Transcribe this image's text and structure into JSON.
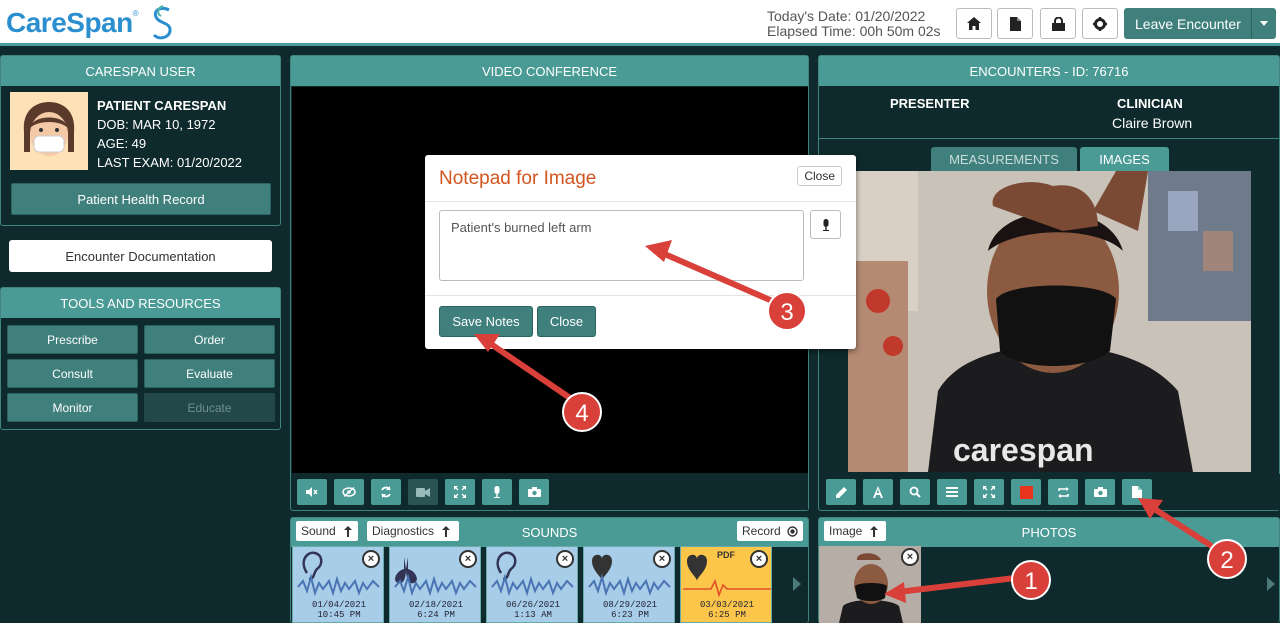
{
  "header": {
    "logo_text": "CareSpan",
    "today_date": "Today's Date: 01/20/2022",
    "elapsed_time": "Elapsed Time: 00h 50m 02s",
    "leave_label": "Leave Encounter"
  },
  "patient_panel": {
    "title": "CARESPAN USER",
    "name": "PATIENT CARESPAN",
    "dob": "DOB: MAR 10, 1972",
    "age": "AGE: 49",
    "last_exam": "LAST EXAM: 01/20/2022",
    "health_record_label": "Patient Health Record"
  },
  "encounter_doc_label": "Encounter Documentation",
  "tools": {
    "title": "TOOLS AND RESOURCES",
    "items": [
      {
        "label": "Prescribe"
      },
      {
        "label": "Order"
      },
      {
        "label": "Consult"
      },
      {
        "label": "Evaluate"
      },
      {
        "label": "Monitor"
      },
      {
        "label": "Educate"
      }
    ]
  },
  "video": {
    "title": "VIDEO CONFERENCE"
  },
  "notepad": {
    "title": "Notepad for Image",
    "close_top": "Close",
    "text": "Patient's burned left arm",
    "save_label": "Save Notes",
    "close_label": "Close"
  },
  "encounters": {
    "title": "ENCOUNTERS - ID: 76716",
    "presenter_label": "PRESENTER",
    "clinician_label": "CLINICIAN",
    "clinician_name": "Claire Brown",
    "tabs": [
      "MEASUREMENTS",
      "IMAGES"
    ],
    "shirt_text": "carespan"
  },
  "sounds": {
    "title": "SOUNDS",
    "sound_btn": "Sound",
    "diagnostics_btn": "Diagnostics",
    "record_btn": "Record",
    "cards": [
      {
        "date": "01/04/2021",
        "time": "10:45 PM",
        "icon": "ear-icon"
      },
      {
        "date": "02/18/2021",
        "time": "6:24 PM",
        "icon": "lungs-icon"
      },
      {
        "date": "06/26/2021",
        "time": "1:13 AM",
        "icon": "ear-icon"
      },
      {
        "date": "08/29/2021",
        "time": "6:23 PM",
        "icon": "heart-icon"
      },
      {
        "date": "03/03/2021",
        "time": "6:25 PM",
        "icon": "heart-pdf-icon",
        "tag": "PDF"
      }
    ]
  },
  "photos": {
    "title": "PHOTOS",
    "image_btn": "Image"
  },
  "annotations": [
    "1",
    "2",
    "3",
    "4"
  ],
  "colors": {
    "teal": "#4a9a96",
    "dark_bg": "#0f2a2c",
    "accent_orange": "#d4551f",
    "annot_red": "#d9403a"
  }
}
